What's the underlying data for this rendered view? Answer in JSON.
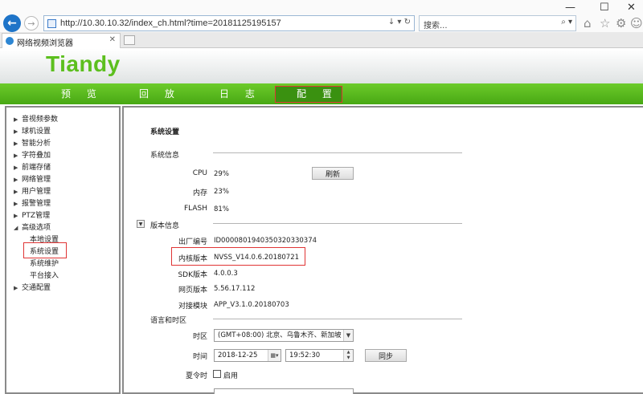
{
  "browser": {
    "address": "http://10.30.10.32/index_ch.html?time=20181125195157",
    "search_placeholder": "搜索...",
    "tab_title": "网络视频浏览器",
    "back_glyph": "←",
    "forward_glyph": "→",
    "minimize": "—",
    "maximize": "☐",
    "close": "✕",
    "tab_close": "✕",
    "addr_tools": "↓ ▾ ↻",
    "search_tools": "⌕ ▾"
  },
  "app": {
    "logo": "Tiandy",
    "accent": "#5cbf1e"
  },
  "menu": {
    "preview": "预 览",
    "playback": "回 放",
    "log": "日 志",
    "config": "配 置"
  },
  "tree": {
    "items": [
      "音视频参数",
      "球机设置",
      "智能分析",
      "字符叠加",
      "前端存储",
      "网络管理",
      "用户管理",
      "报警管理",
      "PTZ管理",
      "高级选项"
    ],
    "advanced_children": [
      "本地设置",
      "系统设置",
      "系统维护",
      "平台接入"
    ],
    "last": "交通配置"
  },
  "system": {
    "title": "系统设置",
    "section_info": "系统信息",
    "cpu_label": "CPU",
    "cpu_value": "29%",
    "mem_label": "内存",
    "mem_value": "23%",
    "flash_label": "FLASH",
    "flash_value": "81%",
    "refresh_button": "刷新",
    "section_version": "版本信息",
    "factory_label": "出厂编号",
    "factory_value": "ID000080194035032033037​4",
    "kernel_label": "内核版本",
    "kernel_value": "NVSS_V14.0.6.20180721",
    "sdk_label": "SDK版本",
    "sdk_value": "4.0.0.3",
    "web_label": "网页版本",
    "web_value": "5.56.17.112",
    "docking_label": "对接模块",
    "docking_value": "APP_V3.1.0.20180703",
    "section_lang": "语言和时区",
    "tz_label": "时区",
    "tz_value": "(GMT+08:00) 北京、乌鲁木齐、新加坡",
    "time_label": "时间",
    "date_value": "2018-12-25",
    "time_value": "19:52:30",
    "sync_button": "同步",
    "dst_label": "夏令时",
    "dst_enable": "启用"
  }
}
